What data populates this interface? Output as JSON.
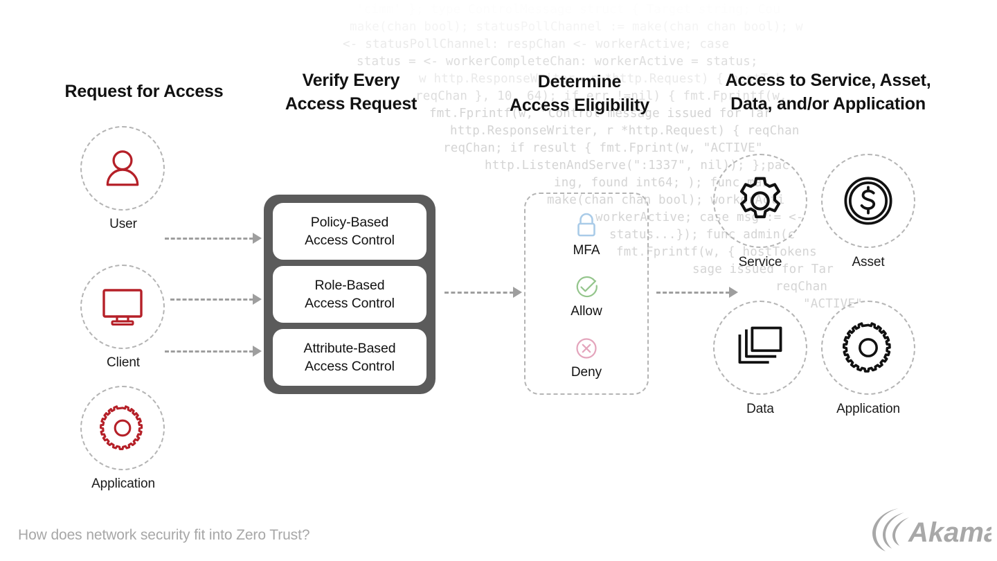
{
  "diagram": {
    "title_caption": "How does network security fit into Zero Trust?",
    "brand": "Akamai",
    "accent_red": "#b52028",
    "dark_box": "#5b5b5b",
    "dashed_gray": "#b4b4b4",
    "arrow_gray": "#9e9e9e",
    "lock_blue": "#a9cbe8",
    "allow_green": "#94c58c",
    "deny_pink": "#e4a5bc"
  },
  "headings": {
    "request": "Request for Access",
    "verify": "Verify Every\nAccess Request",
    "verify_line1": "Verify Every",
    "verify_line2": "Access Request",
    "determine_line1": "Determine",
    "determine_line2": "Access Eligibility",
    "access_line1": "Access to Service, Asset,",
    "access_line2": "Data, and/or Application"
  },
  "sources": [
    {
      "label": "User",
      "icon": "user-icon"
    },
    {
      "label": "Client",
      "icon": "monitor-icon"
    },
    {
      "label": "Application",
      "icon": "gear-icon"
    }
  ],
  "access_controls": [
    {
      "line1": "Policy-Based",
      "line2": "Access Control"
    },
    {
      "line1": "Role-Based",
      "line2": "Access Control"
    },
    {
      "line1": "Attribute-Based",
      "line2": "Access Control"
    }
  ],
  "decisions": [
    {
      "label": "MFA",
      "icon": "lock-icon",
      "color": "#a9cbe8"
    },
    {
      "label": "Allow",
      "icon": "check-circle-icon",
      "color": "#94c58c"
    },
    {
      "label": "Deny",
      "icon": "x-circle-icon",
      "color": "#e4a5bc"
    }
  ],
  "targets": [
    {
      "label": "Service",
      "icon": "gear-outline-icon"
    },
    {
      "label": "Asset",
      "icon": "dollar-coin-icon"
    },
    {
      "label": "Data",
      "icon": "layers-icon"
    },
    {
      "label": "Application",
      "icon": "cog-icon"
    }
  ],
  "background_code": [
    "                       'cimm' }; type ControlMessage struct { Target string; Cou",
    "                        make(chan bool); statusPollChannel := make(chan chan bool); w",
    "                      <- statusPollChannel: respChan <- workerActive; case",
    "                  status  = <- workerCompleteChan: workerActive = status;",
    "                      w http.ResponseWriter, r *http.Request) { hostTok",
    "                  reqChan }, 10, 64); if err !=nil) { fmt.Fprintf(w,",
    "                 fmt.Fprintf(w, \"Control message issued for Tar",
    "            http.ResponseWriter, r *http.Request) { reqChan",
    "                 reqChan; if result { fmt.Fprint(w, \"ACTIVE\"",
    "            http.ListenAndServe(\":1337\", nil)); };pac",
    "               ing, found int64; ); func mai",
    "             make(chan chan bool); workerActi",
    "            workerActive; case msg := <-",
    "            status...}); func admin(c",
    "           fmt.Fprintf(w, { hostTokens",
    "           sage issued for Tar",
    "          reqChan",
    "         \"ACTIVE\""
  ]
}
